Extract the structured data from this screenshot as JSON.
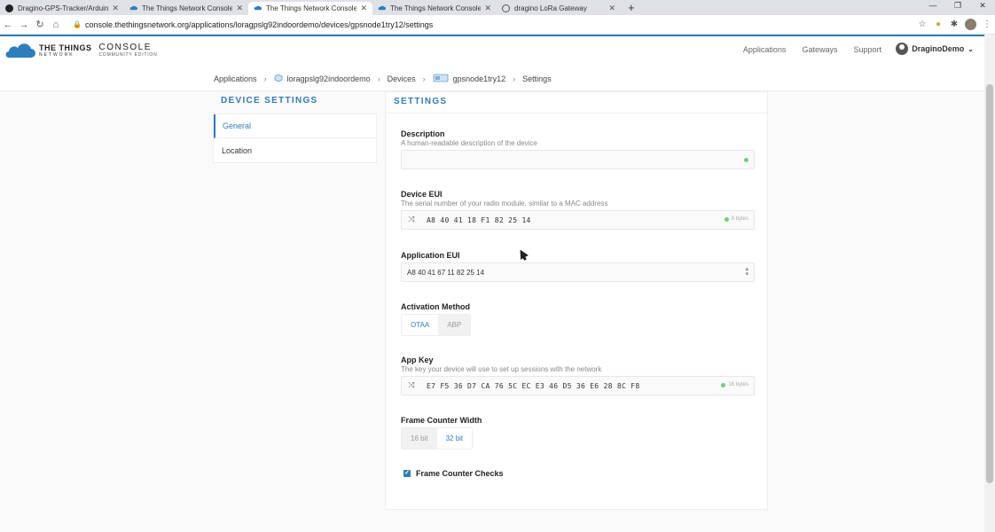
{
  "browser": {
    "tabs": [
      {
        "title": "Dragino-GPS-Tracker/Arduino GI",
        "active": false
      },
      {
        "title": "The Things Network Console",
        "active": false
      },
      {
        "title": "The Things Network Console",
        "active": true
      },
      {
        "title": "The Things Network Console",
        "active": false
      },
      {
        "title": "dragino LoRa Gateway",
        "active": false
      }
    ],
    "url": "console.thethingsnetwork.org/applications/loragpslg92indoordemo/devices/gpsnode1try12/settings"
  },
  "header": {
    "logo_main": "THE THINGS",
    "logo_sub": "NETWORK",
    "logo_console": "CONSOLE",
    "logo_edition": "COMMUNITY EDITION",
    "nav": [
      "Applications",
      "Gateways",
      "Support"
    ],
    "username": "DraginoDemo"
  },
  "breadcrumbs": [
    "Applications",
    "loragpslg92indoordemo",
    "Devices",
    "gpsnode1try12",
    "Settings"
  ],
  "sidebar": {
    "title": "DEVICE SETTINGS",
    "items": [
      "General",
      "Location"
    ]
  },
  "settings": {
    "title": "SETTINGS",
    "description": {
      "label": "Description",
      "help": "A human-readable description of the device",
      "value": ""
    },
    "device_eui": {
      "label": "Device EUI",
      "help": "The serial number of your radio module, similar to a MAC address",
      "value": "A8  40  41  18  F1  82  25  14",
      "bytes": "8 bytes"
    },
    "app_eui": {
      "label": "Application EUI",
      "value": "A8 40 41 67 11 82 25 14"
    },
    "activation": {
      "label": "Activation Method",
      "options": [
        "OTAA",
        "ABP"
      ],
      "selected": "OTAA"
    },
    "app_key": {
      "label": "App Key",
      "help": "The key your device will use to set up sessions with the network",
      "value": "E7  F5  36  D7  CA  76  5C  EC  E3  46  D5  36  E6  28  8C  F8",
      "bytes": "16 bytes"
    },
    "frame_counter_width": {
      "label": "Frame Counter Width",
      "options": [
        "16 bit",
        "32 bit"
      ],
      "selected": "32 bit"
    },
    "frame_counter_checks": {
      "label": "Frame Counter Checks",
      "checked": true
    }
  },
  "colors": {
    "accent": "#2d7ebd",
    "valid": "#6fcf76"
  }
}
